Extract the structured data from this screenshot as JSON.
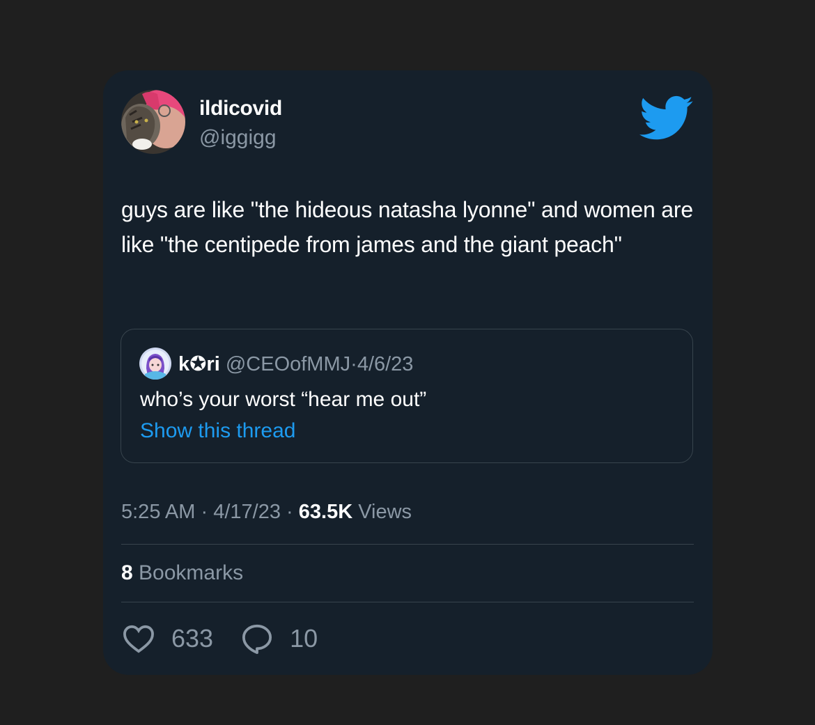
{
  "author": {
    "display_name": "ildicovid",
    "handle": "@iggigg"
  },
  "brand": {
    "icon": "twitter-bird-icon",
    "color": "#1d9bf0"
  },
  "tweet": {
    "text": "guys are like \"the hideous natasha lyonne\" and women are like \"the centipede from james and the giant peach\""
  },
  "quoted_tweet": {
    "name": "k✪ri",
    "handle": "@CEOofMMJ",
    "separator": "·",
    "date": "4/6/23",
    "text": "who’s your worst “hear me out”",
    "link_label": "Show this thread"
  },
  "meta": {
    "time": "5:25 AM",
    "date": "4/17/23",
    "separator": "·",
    "views_count": "63.5K",
    "views_label": "Views"
  },
  "bookmarks": {
    "count": "8",
    "label": "Bookmarks"
  },
  "actions": {
    "likes": "633",
    "replies": "10"
  },
  "colors": {
    "background": "#1f1f1f",
    "card": "#15202b",
    "text_primary": "#ffffff",
    "text_secondary": "#8b98a5",
    "accent": "#1d9bf0",
    "border": "#38444d"
  }
}
